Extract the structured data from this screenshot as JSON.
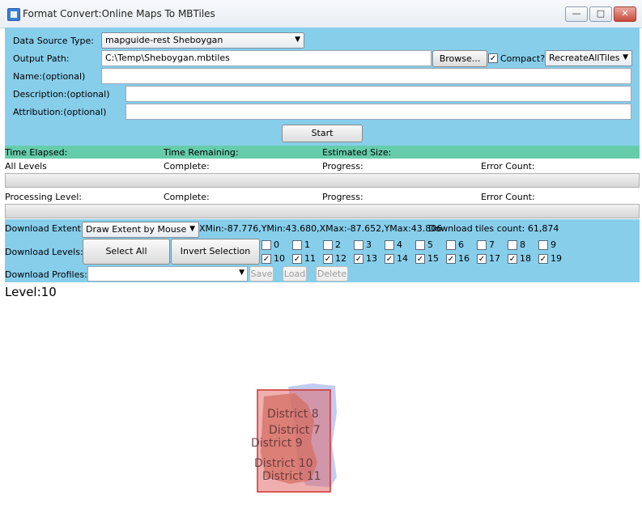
{
  "window": {
    "title": "Format Convert:Online Maps To MBTiles",
    "minimize": "—",
    "maximize": "□",
    "close": "✕"
  },
  "form": {
    "data_source_label": "Data Source Type:",
    "data_source_value": "mapguide-rest Sheboygan",
    "output_path_label": "Output Path:",
    "output_path_value": "C:\\Temp\\Sheboygan.mbtiles",
    "browse_label": "Browse...",
    "compact_label": "Compact?",
    "compact_checked": true,
    "mode_value": "RecreateAllTiles",
    "name_label": "Name:(optional)",
    "description_label": "Description:(optional)",
    "attribution_label": "Attribution:(optional)",
    "start_label": "Start"
  },
  "status": {
    "time_elapsed": "Time Elapsed:",
    "time_remaining": "Time Remaining:",
    "estimated_size": "Estimated Size:",
    "all_levels": "All Levels",
    "complete": "Complete:",
    "progress": "Progress:",
    "error_count": "Error Count:",
    "processing_level": "Processing Level:"
  },
  "extent": {
    "label": "Download Extent:",
    "mode_value": "Draw Extent by Mouse",
    "bounds": "XMin:-87.776,YMin:43.680,XMax:-87.652,YMax:43.806",
    "tiles_count": "Download tiles count: 61,874"
  },
  "levels": {
    "label": "Download Levels:",
    "select_all": "Select All",
    "invert_selection": "Invert Selection",
    "row1": [
      {
        "label": "0",
        "checked": false
      },
      {
        "label": "1",
        "checked": false
      },
      {
        "label": "2",
        "checked": false
      },
      {
        "label": "3",
        "checked": false
      },
      {
        "label": "4",
        "checked": false
      },
      {
        "label": "5",
        "checked": false
      },
      {
        "label": "6",
        "checked": false
      },
      {
        "label": "7",
        "checked": false
      },
      {
        "label": "8",
        "checked": false
      },
      {
        "label": "9",
        "checked": false
      }
    ],
    "row2": [
      {
        "label": "10",
        "checked": true
      },
      {
        "label": "11",
        "checked": true
      },
      {
        "label": "12",
        "checked": true
      },
      {
        "label": "13",
        "checked": true
      },
      {
        "label": "14",
        "checked": true
      },
      {
        "label": "15",
        "checked": true
      },
      {
        "label": "16",
        "checked": true
      },
      {
        "label": "17",
        "checked": true
      },
      {
        "label": "18",
        "checked": true
      },
      {
        "label": "19",
        "checked": true
      }
    ]
  },
  "profiles": {
    "label": "Download Profiles:",
    "save": "Save",
    "load": "Load",
    "delete": "Delete"
  },
  "map": {
    "level_text": "Level:10",
    "district_labels": [
      "District 8",
      "District 7",
      "District 9",
      "District 10",
      "District 11"
    ],
    "extent_color": "#e06060"
  }
}
